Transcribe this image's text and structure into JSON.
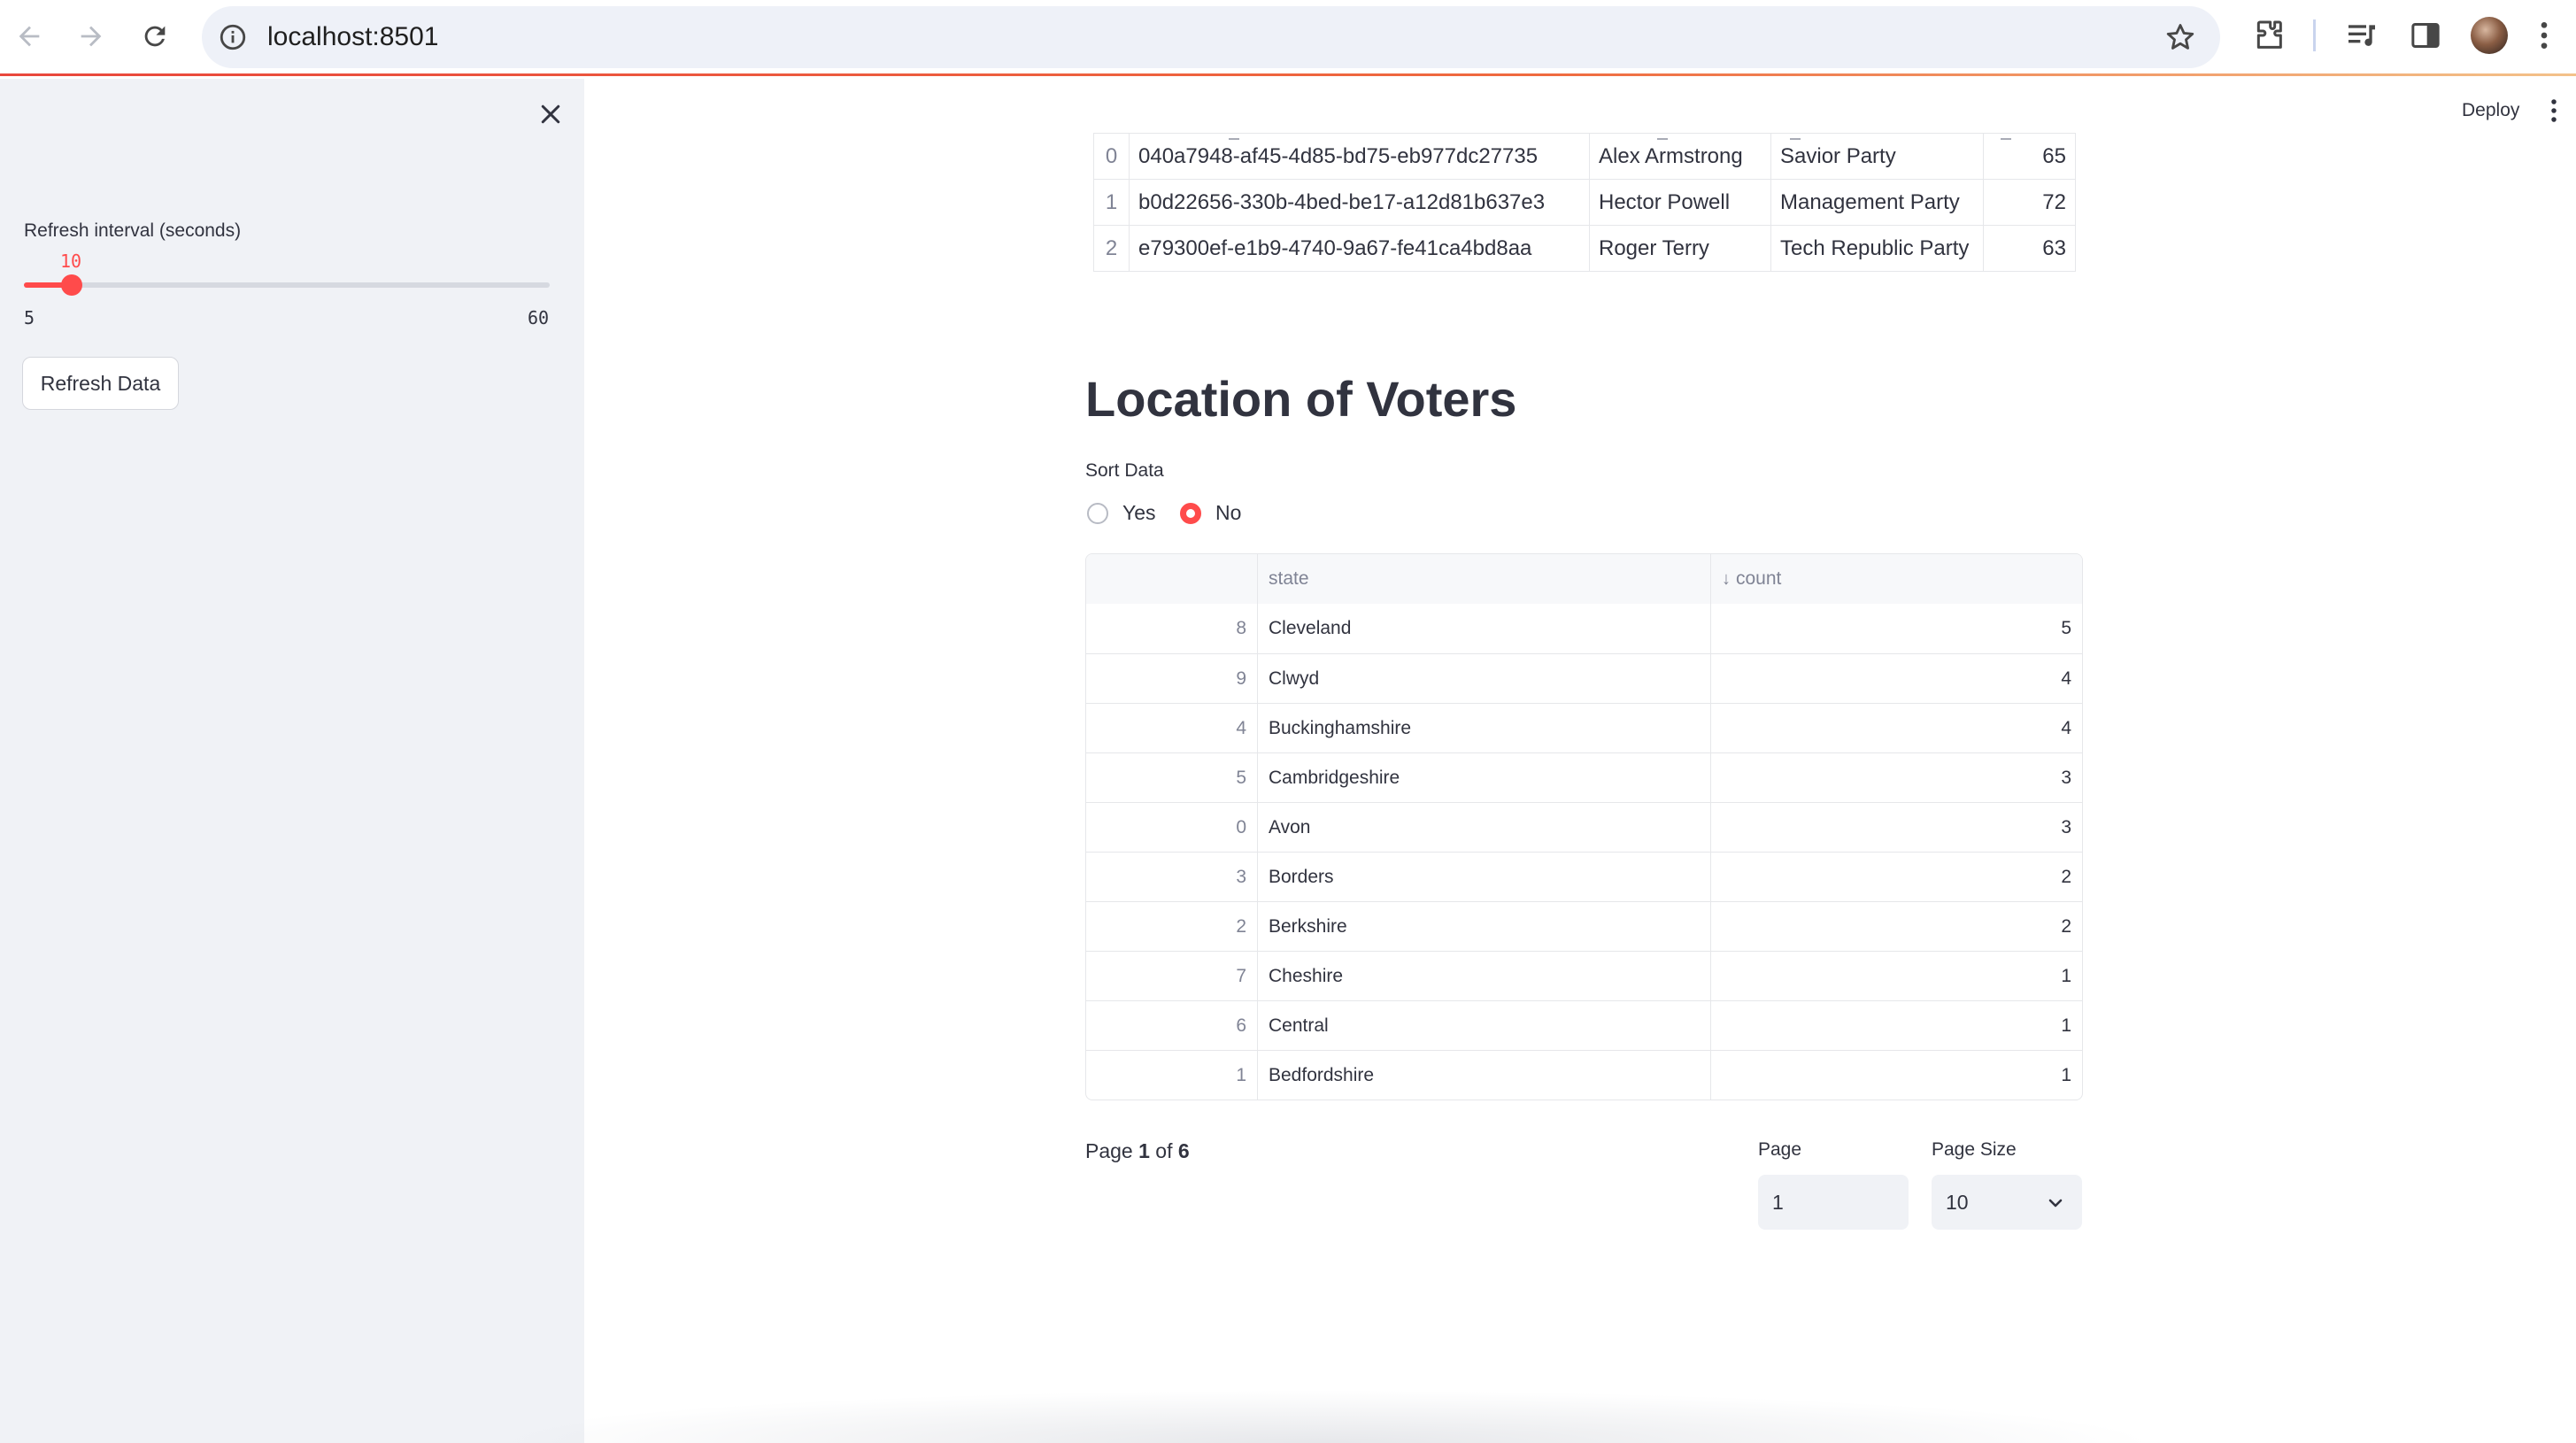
{
  "browser": {
    "url": "localhost:8501"
  },
  "sidebar": {
    "slider_label": "Refresh interval (seconds)",
    "slider_value": "10",
    "slider_min": "5",
    "slider_max": "60",
    "slider_fraction": 0.0909,
    "refresh_button": "Refresh Data"
  },
  "header": {
    "deploy_label": "Deploy"
  },
  "candidates_table": {
    "rows": [
      {
        "index": "0",
        "id": "040a7948-af45-4d85-bd75-eb977dc27735",
        "name": "Alex Armstrong",
        "party": "Savior Party",
        "age": "65"
      },
      {
        "index": "1",
        "id": "b0d22656-330b-4bed-be17-a12d81b637e3",
        "name": "Hector Powell",
        "party": "Management Party",
        "age": "72"
      },
      {
        "index": "2",
        "id": "e79300ef-e1b9-4740-9a67-fe41ca4bd8aa",
        "name": "Roger Terry",
        "party": "Tech Republic Party",
        "age": "63"
      }
    ]
  },
  "location": {
    "title": "Location of Voters",
    "sort_label": "Sort Data",
    "sort_options": [
      "Yes",
      "No"
    ],
    "sort_selected": "No",
    "columns": {
      "state": "state",
      "count": "count"
    },
    "rows": [
      {
        "index": "8",
        "state": "Cleveland",
        "count": "5"
      },
      {
        "index": "9",
        "state": "Clwyd",
        "count": "4"
      },
      {
        "index": "4",
        "state": "Buckinghamshire",
        "count": "4"
      },
      {
        "index": "5",
        "state": "Cambridgeshire",
        "count": "3"
      },
      {
        "index": "0",
        "state": "Avon",
        "count": "3"
      },
      {
        "index": "3",
        "state": "Borders",
        "count": "2"
      },
      {
        "index": "2",
        "state": "Berkshire",
        "count": "2"
      },
      {
        "index": "7",
        "state": "Cheshire",
        "count": "1"
      },
      {
        "index": "6",
        "state": "Central",
        "count": "1"
      },
      {
        "index": "1",
        "state": "Bedfordshire",
        "count": "1"
      }
    ]
  },
  "pagination": {
    "page_prefix": "Page ",
    "current_page": "1",
    "of_text": " of ",
    "total_pages": "6",
    "page_label": "Page",
    "page_value": "1",
    "page_size_label": "Page Size",
    "page_size_value": "10"
  },
  "colors": {
    "accent": "#ff4b4b",
    "sidebar_bg": "#f0f2f6",
    "text": "#31333f"
  }
}
